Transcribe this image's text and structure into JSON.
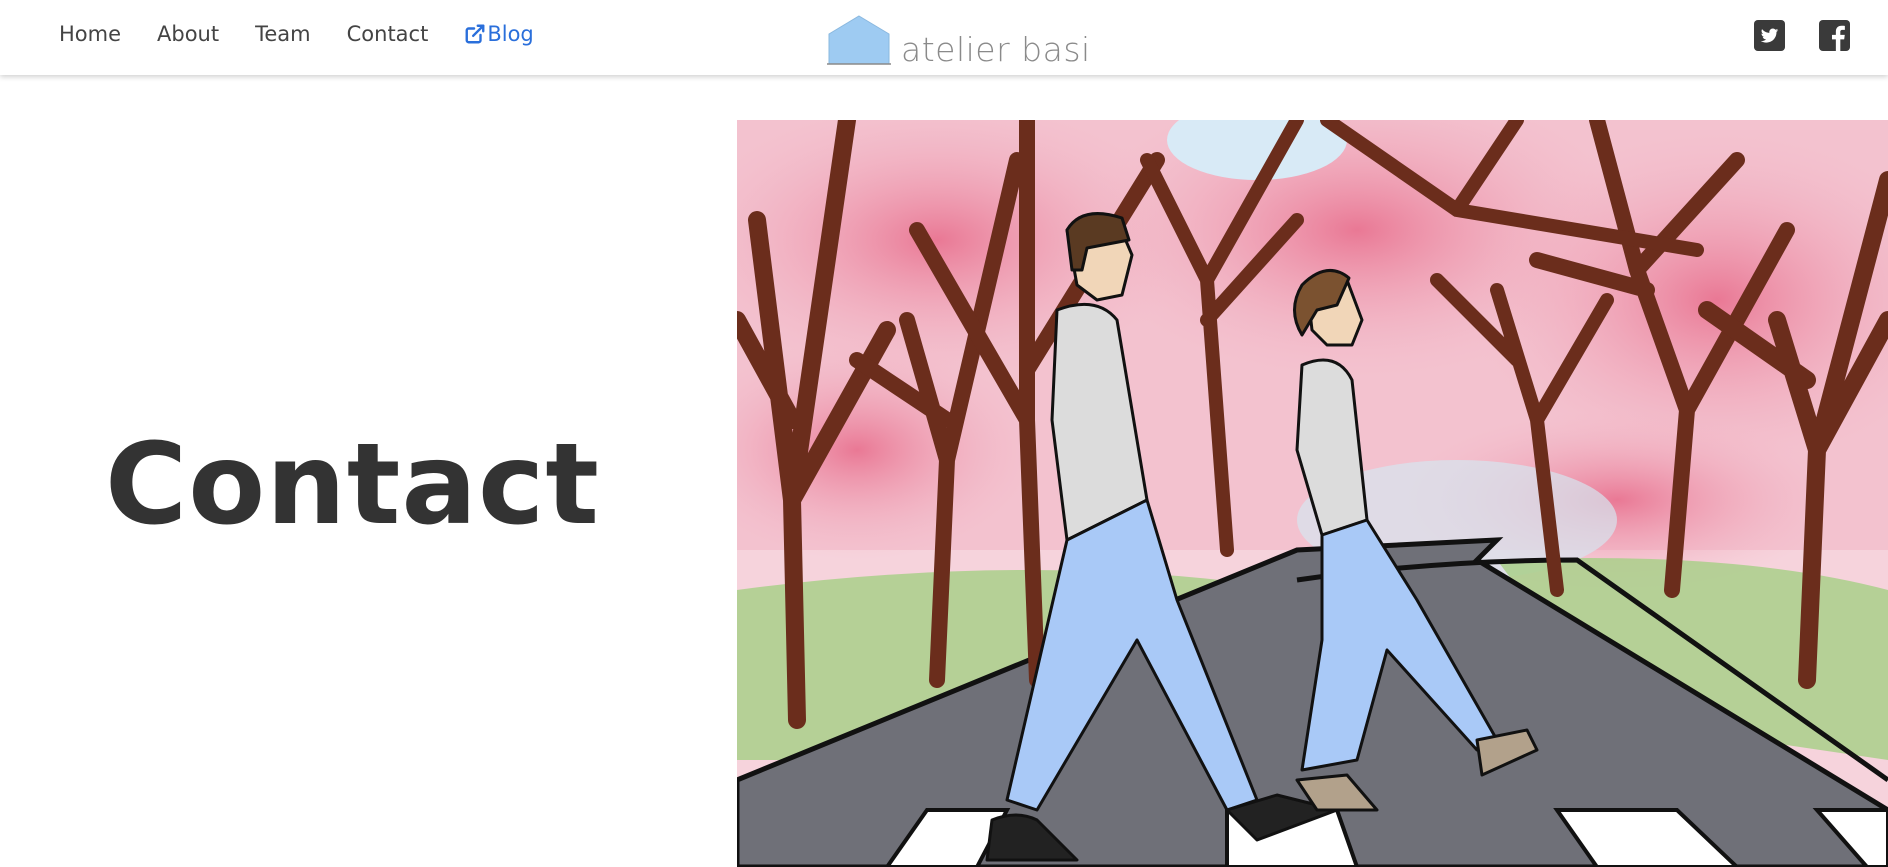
{
  "nav": {
    "links": [
      {
        "label": "Home"
      },
      {
        "label": "About"
      },
      {
        "label": "Team"
      },
      {
        "label": "Contact"
      }
    ],
    "blog": {
      "label": "Blog",
      "icon": "external-link-icon",
      "color": "#2a6fdb"
    }
  },
  "brand": {
    "name": "atelier basi",
    "icon": "house-logo-icon",
    "icon_color": "#9ecbf2"
  },
  "social": [
    {
      "icon": "twitter-icon"
    },
    {
      "icon": "facebook-icon"
    }
  ],
  "hero": {
    "title": "Contact"
  },
  "illustration": {
    "description_icon": "couple-walking-illustration"
  }
}
